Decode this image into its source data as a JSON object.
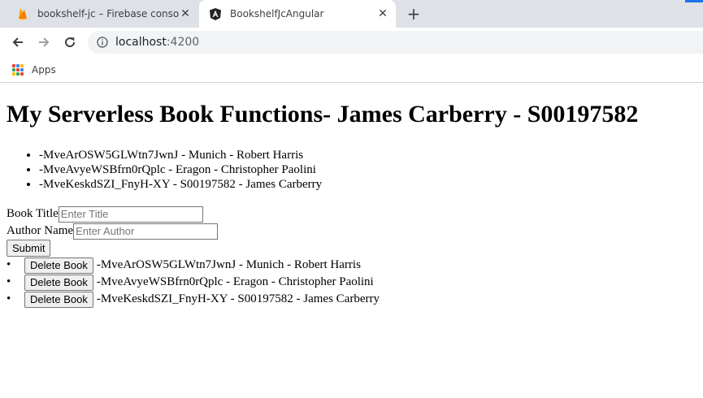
{
  "browser": {
    "tabs": [
      {
        "title": "bookshelf-jc – Firebase console",
        "icon": "firebase-icon",
        "active": false
      },
      {
        "title": "BookshelfJcAngular",
        "icon": "angular-icon",
        "active": true
      }
    ],
    "new_tab_label": "+",
    "url_host": "localhost",
    "url_port": ":4200",
    "bookmarks": [
      {
        "label": "Apps",
        "icon": "apps-grid-icon"
      }
    ]
  },
  "page": {
    "title": "My Serverless Book Functions- James Carberry - S00197582",
    "books": [
      "-MveArOSW5GLWtn7JwnJ - Munich - Robert Harris",
      "-MveAvyeWSBfrn0rQplc - Eragon - Christopher Paolini",
      "-MveKeskdSZI_FnyH-XY - S00197582 - James Carberry"
    ],
    "form": {
      "title_label": "Book Title",
      "title_placeholder": "Enter Title",
      "author_label": "Author Name",
      "author_placeholder": "Enter Author",
      "submit_label": "Submit"
    },
    "delete_label": "Delete Book",
    "delete_items": [
      "-MveArOSW5GLWtn7JwnJ - Munich - Robert Harris",
      "-MveAvyeWSBfrn0rQplc - Eragon - Christopher Paolini",
      "-MveKeskdSZI_FnyH-XY - S00197582 - James Carberry"
    ]
  }
}
